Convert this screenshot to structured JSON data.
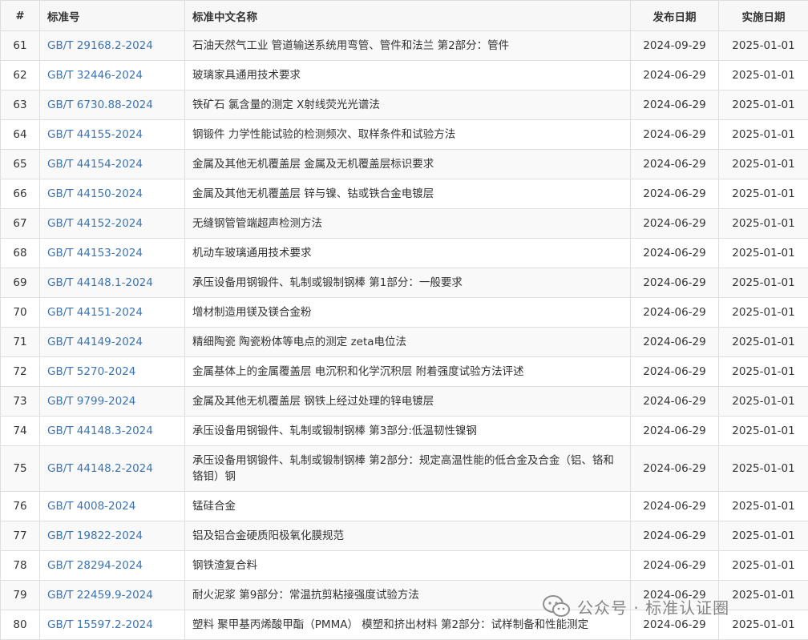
{
  "table": {
    "headers": {
      "no": "#",
      "code": "标准号",
      "name": "标准中文名称",
      "publish": "发布日期",
      "implement": "实施日期"
    },
    "rows": [
      {
        "no": "61",
        "code": "GB/T 29168.2-2024",
        "name": "石油天然气工业 管道输送系统用弯管、管件和法兰 第2部分：管件",
        "publish": "2024-09-29",
        "implement": "2025-01-01"
      },
      {
        "no": "62",
        "code": "GB/T 32446-2024",
        "name": "玻璃家具通用技术要求",
        "publish": "2024-06-29",
        "implement": "2025-01-01"
      },
      {
        "no": "63",
        "code": "GB/T 6730.88-2024",
        "name": "铁矿石 氯含量的测定 X射线荧光光谱法",
        "publish": "2024-06-29",
        "implement": "2025-01-01"
      },
      {
        "no": "64",
        "code": "GB/T 44155-2024",
        "name": "钢锻件 力学性能试验的检测频次、取样条件和试验方法",
        "publish": "2024-06-29",
        "implement": "2025-01-01"
      },
      {
        "no": "65",
        "code": "GB/T 44154-2024",
        "name": "金属及其他无机覆盖层 金属及无机覆盖层标识要求",
        "publish": "2024-06-29",
        "implement": "2025-01-01"
      },
      {
        "no": "66",
        "code": "GB/T 44150-2024",
        "name": "金属及其他无机覆盖层 锌与镍、钴或铁合金电镀层",
        "publish": "2024-06-29",
        "implement": "2025-01-01"
      },
      {
        "no": "67",
        "code": "GB/T 44152-2024",
        "name": "无缝钢管管端超声检测方法",
        "publish": "2024-06-29",
        "implement": "2025-01-01"
      },
      {
        "no": "68",
        "code": "GB/T 44153-2024",
        "name": "机动车玻璃通用技术要求",
        "publish": "2024-06-29",
        "implement": "2025-01-01"
      },
      {
        "no": "69",
        "code": "GB/T 44148.1-2024",
        "name": "承压设备用钢锻件、轧制或锻制钢棒 第1部分：一般要求",
        "publish": "2024-06-29",
        "implement": "2025-01-01"
      },
      {
        "no": "70",
        "code": "GB/T 44151-2024",
        "name": "增材制造用镁及镁合金粉",
        "publish": "2024-06-29",
        "implement": "2025-01-01"
      },
      {
        "no": "71",
        "code": "GB/T 44149-2024",
        "name": "精细陶瓷 陶瓷粉体等电点的测定 zeta电位法",
        "publish": "2024-06-29",
        "implement": "2025-01-01"
      },
      {
        "no": "72",
        "code": "GB/T 5270-2024",
        "name": "金属基体上的金属覆盖层 电沉积和化学沉积层 附着强度试验方法评述",
        "publish": "2024-06-29",
        "implement": "2025-01-01"
      },
      {
        "no": "73",
        "code": "GB/T 9799-2024",
        "name": "金属及其他无机覆盖层 钢铁上经过处理的锌电镀层",
        "publish": "2024-06-29",
        "implement": "2025-01-01"
      },
      {
        "no": "74",
        "code": "GB/T 44148.3-2024",
        "name": "承压设备用钢锻件、轧制或锻制钢棒 第3部分:低温韧性镍钢",
        "publish": "2024-06-29",
        "implement": "2025-01-01"
      },
      {
        "no": "75",
        "code": "GB/T 44148.2-2024",
        "name": "承压设备用钢锻件、轧制或锻制钢棒 第2部分：规定高温性能的低合金及合金（铝、铬和铬钼）钢",
        "publish": "2024-06-29",
        "implement": "2025-01-01"
      },
      {
        "no": "76",
        "code": "GB/T 4008-2024",
        "name": "锰硅合金",
        "publish": "2024-06-29",
        "implement": "2025-01-01"
      },
      {
        "no": "77",
        "code": "GB/T 19822-2024",
        "name": "铝及铝合金硬质阳极氧化膜规范",
        "publish": "2024-06-29",
        "implement": "2025-01-01"
      },
      {
        "no": "78",
        "code": "GB/T 28294-2024",
        "name": "钢铁渣复合料",
        "publish": "2024-06-29",
        "implement": "2025-01-01"
      },
      {
        "no": "79",
        "code": "GB/T 22459.9-2024",
        "name": "耐火泥浆 第9部分：常温抗剪粘接强度试验方法",
        "publish": "2024-06-29",
        "implement": "2025-01-01"
      },
      {
        "no": "80",
        "code": "GB/T 15597.2-2024",
        "name": "塑料 聚甲基丙烯酸甲酯（PMMA） 模塑和挤出材料 第2部分：试样制备和性能测定",
        "publish": "2024-06-29",
        "implement": "2025-01-01"
      }
    ]
  },
  "watermark": {
    "text": "公众号 · 标准认证圈",
    "icon": "wechat-icon"
  },
  "colors": {
    "link": "#3a74b3",
    "border": "#dedede",
    "stripe": "#f9f9f9",
    "header_bg": "#f7f7f7",
    "text": "#333333",
    "watermark": "#7f7f7f"
  }
}
